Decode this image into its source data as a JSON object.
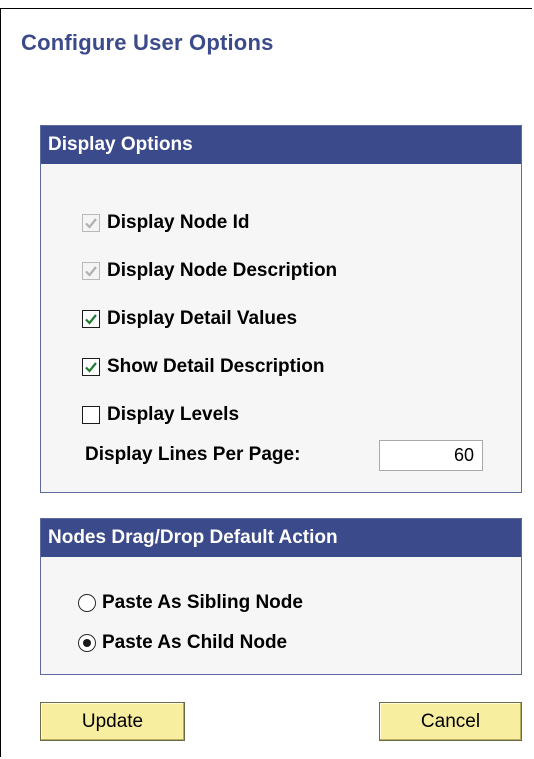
{
  "page": {
    "title": "Configure User Options"
  },
  "display_options": {
    "header": "Display Options",
    "checkboxes": [
      {
        "label": "Display Node Id",
        "checked": true,
        "disabled": true
      },
      {
        "label": "Display Node Description",
        "checked": true,
        "disabled": true
      },
      {
        "label": "Display Detail Values",
        "checked": true,
        "disabled": false
      },
      {
        "label": "Show Detail Description",
        "checked": true,
        "disabled": false
      },
      {
        "label": "Display Levels",
        "checked": false,
        "disabled": false
      }
    ],
    "lines_per_page": {
      "label": "Display Lines Per Page:",
      "value": "60"
    }
  },
  "drag_drop": {
    "header": "Nodes Drag/Drop Default Action",
    "options": [
      {
        "label": "Paste As Sibling Node",
        "selected": false
      },
      {
        "label": "Paste As Child Node",
        "selected": true
      }
    ]
  },
  "buttons": {
    "update": "Update",
    "cancel": "Cancel"
  },
  "colors": {
    "title": "#3b4a8b",
    "group_header_bg": "#3b4a8b",
    "group_bg": "#f6f6f6",
    "button_bg": "#f8eea0",
    "check_enabled": "#1f7a2f",
    "check_disabled": "#b0b0b0"
  }
}
